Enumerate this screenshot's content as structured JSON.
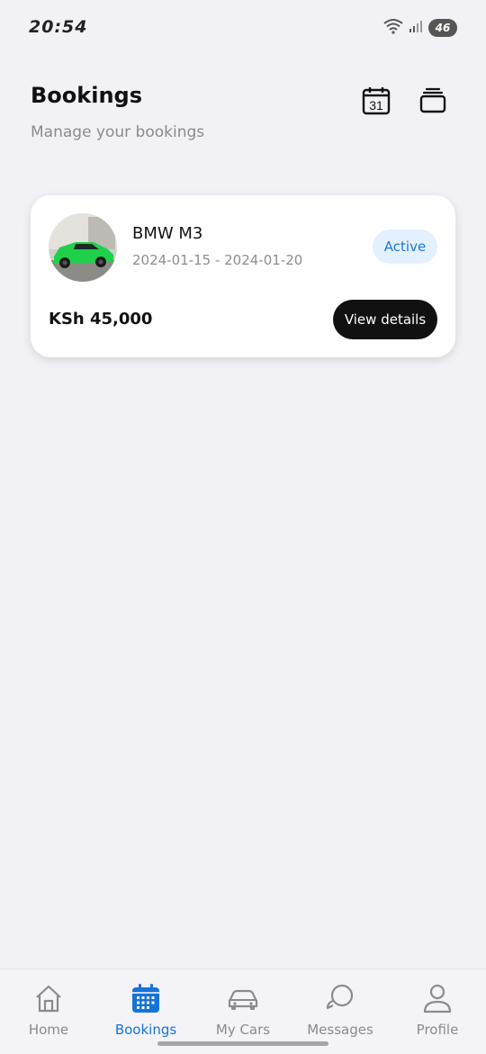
{
  "status_bar": {
    "time": "20:54",
    "battery": "46"
  },
  "header": {
    "title": "Bookings",
    "subtitle": "Manage your bookings",
    "calendar_day": "31",
    "icons": [
      "calendar-icon",
      "stack-icon"
    ]
  },
  "bookings": [
    {
      "car_name": "BMW M3",
      "dates": "2024-01-15 - 2024-01-20",
      "status": "Active",
      "price": "KSh 45,000",
      "action_label": "View details"
    }
  ],
  "nav": {
    "items": [
      {
        "label": "Home",
        "icon": "home-icon"
      },
      {
        "label": "Bookings",
        "icon": "calendar-icon",
        "active": true
      },
      {
        "label": "My Cars",
        "icon": "car-icon"
      },
      {
        "label": "Messages",
        "icon": "chat-icon"
      },
      {
        "label": "Profile",
        "icon": "user-icon"
      }
    ]
  },
  "colors": {
    "accent": "#1673d9",
    "badge_bg": "#e3f0fd",
    "background": "#f2f1f6"
  }
}
